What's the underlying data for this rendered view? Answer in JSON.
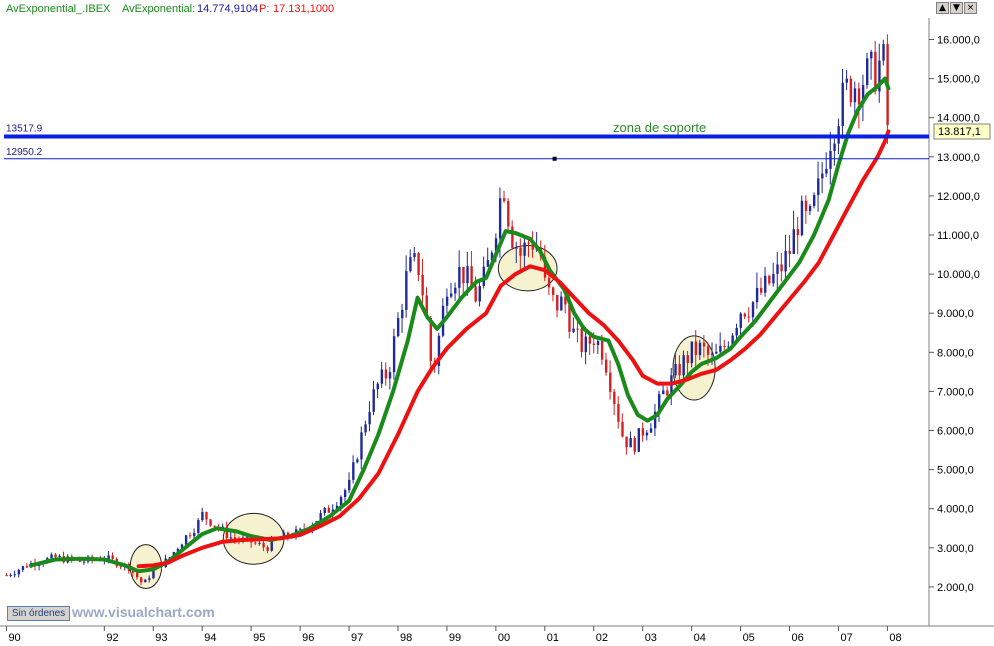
{
  "header": {
    "label1": "AvExponential_.IBEX",
    "label2": "AvExponential:",
    "value2": "14.774,9104",
    "label3": "P:",
    "value3": "17.131,1000"
  },
  "window_buttons": [
    {
      "name": "minimize",
      "glyph": "▲"
    },
    {
      "name": "maximize",
      "glyph": "▼"
    },
    {
      "name": "close",
      "glyph": "×"
    }
  ],
  "orders_button": "Sin órdenes",
  "watermark": "www.visualchart.com",
  "colors": {
    "green_ma": "#1a8a1a",
    "red_ma": "#ee1111",
    "support_line": "#0a1ee6",
    "candle_up": "#1f2a9a",
    "candle_down": "#d42020",
    "annotation": "#2a8a2a",
    "ellipse_fill": "#f5f0c8"
  },
  "chart_data": {
    "type": "candlestick",
    "title": "",
    "instrument": "IBEX",
    "x_tick_labels": [
      "90",
      "92",
      "93",
      "94",
      "95",
      "96",
      "97",
      "98",
      "99",
      "00",
      "01",
      "02",
      "03",
      "04",
      "05",
      "06",
      "07",
      "08"
    ],
    "y_tick_labels": [
      "16.000,0",
      "15.000,0",
      "14.000,0",
      "13.000,0",
      "12.000,0",
      "11.000,0",
      "10.000,0",
      "9.000,0",
      "8.000,0",
      "7.000,0",
      "6.000,0",
      "5.000,0",
      "4.000,0",
      "3.000,0",
      "2.000,0"
    ],
    "y_ticks": [
      16000,
      15000,
      14000,
      13000,
      12000,
      11000,
      10000,
      9000,
      8000,
      7000,
      6000,
      5000,
      4000,
      3000,
      2000
    ],
    "x_ticks": [
      1990,
      1992,
      1993,
      1994,
      1995,
      1996,
      1997,
      1998,
      1999,
      2000,
      2001,
      2002,
      2003,
      2004,
      2005,
      2006,
      2007,
      2008
    ],
    "xlim": [
      1989.95,
      2008.85
    ],
    "ylim": [
      1000,
      16550
    ],
    "last_price": "13.817,1",
    "last_price_value": 13817.1,
    "horizontal_lines": [
      {
        "label": "13517.9",
        "value": 13517.9,
        "style": "thick"
      },
      {
        "label": "12950.2",
        "value": 12950.2,
        "style": "thin"
      }
    ],
    "annotation": "zona de soporte",
    "price_series": [
      [
        1990.0,
        2300
      ],
      [
        1990.5,
        2600
      ],
      [
        1991.0,
        2750
      ],
      [
        1991.5,
        2650
      ],
      [
        1992.0,
        2750
      ],
      [
        1992.5,
        2500
      ],
      [
        1992.8,
        2050
      ],
      [
        1993.0,
        2450
      ],
      [
        1993.3,
        2700
      ],
      [
        1993.6,
        3200
      ],
      [
        1993.9,
        3600
      ],
      [
        1994.0,
        3850
      ],
      [
        1994.3,
        3550
      ],
      [
        1994.6,
        3250
      ],
      [
        1995.0,
        3150
      ],
      [
        1995.3,
        3000
      ],
      [
        1995.6,
        3250
      ],
      [
        1996.0,
        3400
      ],
      [
        1996.3,
        3700
      ],
      [
        1996.6,
        4000
      ],
      [
        1997.0,
        4600
      ],
      [
        1997.2,
        5600
      ],
      [
        1997.4,
        6600
      ],
      [
        1997.6,
        7200
      ],
      [
        1997.8,
        7500
      ],
      [
        1998.0,
        8800
      ],
      [
        1998.2,
        10100
      ],
      [
        1998.4,
        10300
      ],
      [
        1998.55,
        9200
      ],
      [
        1998.7,
        7400
      ],
      [
        1998.85,
        8500
      ],
      [
        1999.0,
        9800
      ],
      [
        1999.3,
        10100
      ],
      [
        1999.6,
        9400
      ],
      [
        1999.8,
        10000
      ],
      [
        2000.0,
        11300
      ],
      [
        2000.15,
        12400
      ],
      [
        2000.3,
        11100
      ],
      [
        2000.5,
        10500
      ],
      [
        2000.7,
        10900
      ],
      [
        2000.9,
        10600
      ],
      [
        2001.0,
        9700
      ],
      [
        2001.2,
        9200
      ],
      [
        2001.4,
        9300
      ],
      [
        2001.6,
        8400
      ],
      [
        2001.8,
        8100
      ],
      [
        2002.0,
        8400
      ],
      [
        2002.2,
        8000
      ],
      [
        2002.4,
        6900
      ],
      [
        2002.6,
        5800
      ],
      [
        2002.8,
        5600
      ],
      [
        2003.0,
        6000
      ],
      [
        2003.2,
        6300
      ],
      [
        2003.4,
        6900
      ],
      [
        2003.6,
        7300
      ],
      [
        2003.8,
        7700
      ],
      [
        2004.0,
        8000
      ],
      [
        2004.2,
        8100
      ],
      [
        2004.4,
        7800
      ],
      [
        2004.6,
        8000
      ],
      [
        2004.8,
        8500
      ],
      [
        2005.0,
        9100
      ],
      [
        2005.2,
        9200
      ],
      [
        2005.4,
        9500
      ],
      [
        2005.6,
        9800
      ],
      [
        2005.8,
        10100
      ],
      [
        2006.0,
        10600
      ],
      [
        2006.2,
        11500
      ],
      [
        2006.4,
        11300
      ],
      [
        2006.6,
        12200
      ],
      [
        2006.8,
        13400
      ],
      [
        2007.0,
        14200
      ],
      [
        2007.2,
        14800
      ],
      [
        2007.4,
        14900
      ],
      [
        2007.6,
        15100
      ],
      [
        2007.8,
        15200
      ],
      [
        2007.9,
        15700
      ],
      [
        2008.0,
        13800
      ]
    ],
    "series": [
      {
        "name": "AvExponential_",
        "color": "#1a8a1a",
        "points": [
          [
            1990.5,
            2550
          ],
          [
            1991.0,
            2700
          ],
          [
            1991.5,
            2720
          ],
          [
            1992.0,
            2700
          ],
          [
            1992.4,
            2560
          ],
          [
            1992.7,
            2400
          ],
          [
            1993.0,
            2450
          ],
          [
            1993.3,
            2650
          ],
          [
            1993.6,
            2950
          ],
          [
            1994.0,
            3350
          ],
          [
            1994.3,
            3500
          ],
          [
            1994.7,
            3420
          ],
          [
            1995.0,
            3300
          ],
          [
            1995.4,
            3200
          ],
          [
            1995.8,
            3300
          ],
          [
            1996.2,
            3500
          ],
          [
            1996.6,
            3800
          ],
          [
            1997.0,
            4200
          ],
          [
            1997.3,
            5000
          ],
          [
            1997.6,
            5900
          ],
          [
            1997.9,
            7000
          ],
          [
            1998.2,
            8300
          ],
          [
            1998.4,
            9400
          ],
          [
            1998.6,
            8900
          ],
          [
            1998.8,
            8600
          ],
          [
            1999.0,
            8900
          ],
          [
            1999.3,
            9400
          ],
          [
            1999.6,
            9800
          ],
          [
            1999.8,
            9900
          ],
          [
            2000.0,
            10500
          ],
          [
            2000.2,
            11100
          ],
          [
            2000.4,
            11050
          ],
          [
            2000.7,
            10900
          ],
          [
            2000.9,
            10600
          ],
          [
            2001.1,
            10100
          ],
          [
            2001.4,
            9600
          ],
          [
            2001.6,
            9000
          ],
          [
            2001.8,
            8600
          ],
          [
            2002.0,
            8400
          ],
          [
            2002.3,
            8300
          ],
          [
            2002.5,
            7700
          ],
          [
            2002.7,
            6900
          ],
          [
            2002.9,
            6400
          ],
          [
            2003.1,
            6250
          ],
          [
            2003.3,
            6400
          ],
          [
            2003.5,
            6800
          ],
          [
            2003.8,
            7200
          ],
          [
            2004.0,
            7500
          ],
          [
            2004.2,
            7700
          ],
          [
            2004.5,
            7850
          ],
          [
            2004.8,
            8100
          ],
          [
            2005.0,
            8400
          ],
          [
            2005.3,
            8800
          ],
          [
            2005.6,
            9300
          ],
          [
            2005.9,
            9800
          ],
          [
            2006.2,
            10300
          ],
          [
            2006.5,
            11000
          ],
          [
            2006.8,
            11900
          ],
          [
            2007.0,
            12800
          ],
          [
            2007.2,
            13600
          ],
          [
            2007.4,
            14200
          ],
          [
            2007.6,
            14600
          ],
          [
            2007.8,
            14800
          ],
          [
            2007.95,
            15000
          ],
          [
            2008.02,
            14750
          ]
        ]
      },
      {
        "name": "AvExponential",
        "color": "#ee1111",
        "points": [
          [
            1992.7,
            2530
          ],
          [
            1993.0,
            2550
          ],
          [
            1993.3,
            2620
          ],
          [
            1993.6,
            2800
          ],
          [
            1994.0,
            3000
          ],
          [
            1994.4,
            3150
          ],
          [
            1994.8,
            3200
          ],
          [
            1995.2,
            3220
          ],
          [
            1995.6,
            3240
          ],
          [
            1996.0,
            3330
          ],
          [
            1996.4,
            3550
          ],
          [
            1996.8,
            3800
          ],
          [
            1997.2,
            4250
          ],
          [
            1997.6,
            4900
          ],
          [
            1998.0,
            5900
          ],
          [
            1998.4,
            7000
          ],
          [
            1998.7,
            7600
          ],
          [
            1999.0,
            8100
          ],
          [
            1999.4,
            8600
          ],
          [
            1999.8,
            9000
          ],
          [
            2000.1,
            9700
          ],
          [
            2000.4,
            10000
          ],
          [
            2000.7,
            10200
          ],
          [
            2001.0,
            10100
          ],
          [
            2001.3,
            9800
          ],
          [
            2001.6,
            9400
          ],
          [
            2001.9,
            9000
          ],
          [
            2002.2,
            8700
          ],
          [
            2002.5,
            8300
          ],
          [
            2002.8,
            7800
          ],
          [
            2003.0,
            7400
          ],
          [
            2003.3,
            7200
          ],
          [
            2003.6,
            7200
          ],
          [
            2003.9,
            7300
          ],
          [
            2004.2,
            7450
          ],
          [
            2004.5,
            7550
          ],
          [
            2004.8,
            7800
          ],
          [
            2005.1,
            8100
          ],
          [
            2005.4,
            8450
          ],
          [
            2005.7,
            8900
          ],
          [
            2006.0,
            9350
          ],
          [
            2006.3,
            9800
          ],
          [
            2006.6,
            10300
          ],
          [
            2006.9,
            11000
          ],
          [
            2007.2,
            11700
          ],
          [
            2007.5,
            12400
          ],
          [
            2007.8,
            13000
          ],
          [
            2007.95,
            13400
          ],
          [
            2008.02,
            13650
          ]
        ]
      }
    ]
  }
}
